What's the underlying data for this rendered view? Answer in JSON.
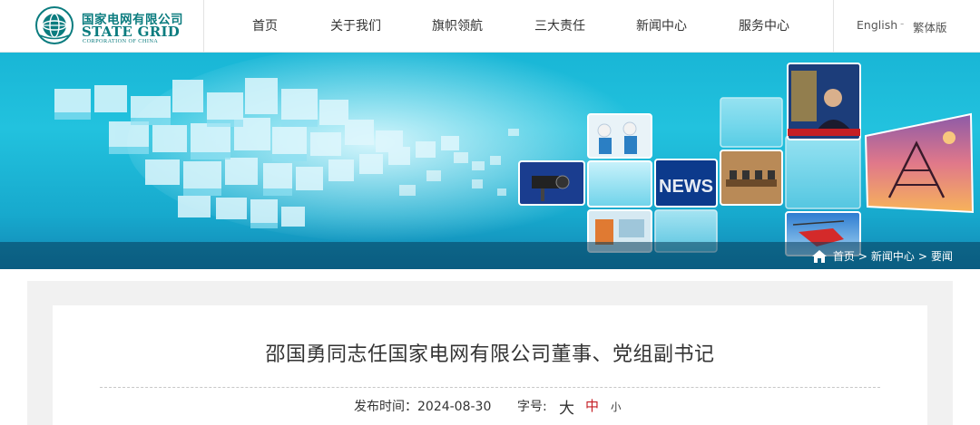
{
  "logo": {
    "name_cn": "国家电网有限公司",
    "name_en": "STATE GRID",
    "subtitle": "CORPORATION OF CHINA",
    "icon": "state-grid-emblem"
  },
  "nav": {
    "items": [
      {
        "label": "首页"
      },
      {
        "label": "关于我们"
      },
      {
        "label": "旗帜领航"
      },
      {
        "label": "三大责任"
      },
      {
        "label": "新闻中心"
      },
      {
        "label": "服务中心"
      }
    ]
  },
  "lang": {
    "english": "English",
    "separator": "-",
    "traditional": "繁体版"
  },
  "breadcrumb": {
    "icon": "home-icon",
    "items": [
      "首页",
      "新闻中心",
      "要闻"
    ],
    "separator": ">"
  },
  "article": {
    "title": "邵国勇同志任国家电网有限公司董事、党组副书记",
    "publish_label": "发布时间：",
    "publish_date": "2024-08-30",
    "font_size_label": "字号:",
    "font_large": "大",
    "font_medium": "中",
    "font_small": "小"
  },
  "colors": {
    "brand": "#0b7c7f",
    "banner": "#1cb7d8",
    "accent_red": "#c41e24"
  }
}
